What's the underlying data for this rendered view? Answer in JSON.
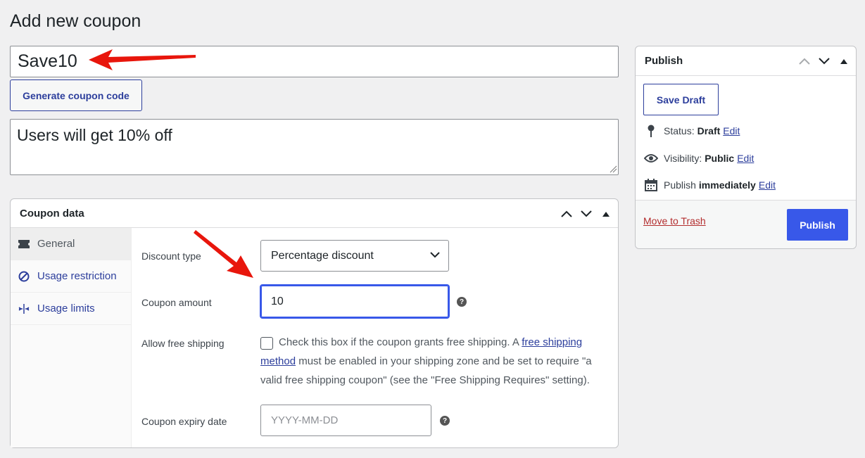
{
  "page": {
    "title": "Add new coupon"
  },
  "coupon": {
    "code_value": "Save10",
    "generate_label": "Generate coupon code",
    "description_value": "Users will get 10% off"
  },
  "coupon_data": {
    "title": "Coupon data",
    "tabs": [
      {
        "label": "General",
        "icon": "ticket-icon",
        "active": true
      },
      {
        "label": "Usage restriction",
        "icon": "block-icon",
        "active": false
      },
      {
        "label": "Usage limits",
        "icon": "limits-icon",
        "active": false
      }
    ],
    "fields": {
      "discount_type_label": "Discount type",
      "discount_type_value": "Percentage discount",
      "coupon_amount_label": "Coupon amount",
      "coupon_amount_value": "10",
      "free_shipping_label": "Allow free shipping",
      "free_shipping_text_1": "Check this box if the coupon grants free shipping. A ",
      "free_shipping_link": "free shipping method",
      "free_shipping_text_2": " must be enabled in your shipping zone and be set to require \"a valid free shipping coupon\" (see the \"Free Shipping Requires\" setting).",
      "expiry_label": "Coupon expiry date",
      "expiry_placeholder": "YYYY-MM-DD"
    }
  },
  "publish": {
    "title": "Publish",
    "save_draft_label": "Save Draft",
    "status_label": "Status:",
    "status_value": "Draft",
    "visibility_label": "Visibility:",
    "visibility_value": "Public",
    "publish_label": "Publish",
    "publish_value": "immediately",
    "edit_label": "Edit",
    "trash_label": "Move to Trash",
    "publish_button_label": "Publish"
  },
  "colors": {
    "accent": "#3858e9",
    "link": "#2c3e9c",
    "trash": "#b32d2e",
    "annotation_arrow": "#e8160c"
  }
}
